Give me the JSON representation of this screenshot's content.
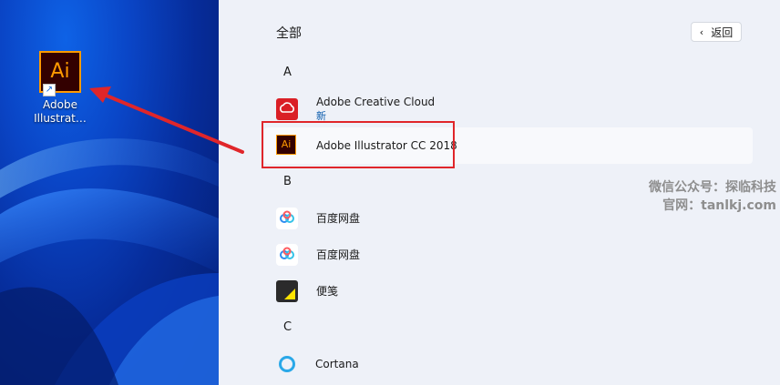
{
  "desktop": {
    "shortcut_label": "Adobe Illustrat…",
    "shortcut_label_line1": "Adobe",
    "shortcut_label_line2": "Illustrat…",
    "icon_text": "Ai"
  },
  "start_menu": {
    "section_title": "全部",
    "back_label": "返回",
    "groups": [
      {
        "letter": "A",
        "apps": [
          {
            "name": "Adobe Creative Cloud",
            "sub": "新",
            "icon": "creative-cloud-icon"
          },
          {
            "name": "Adobe Illustrator CC 2018",
            "icon": "illustrator-icon",
            "icon_text": "Ai"
          }
        ]
      },
      {
        "letter": "B",
        "apps": [
          {
            "name": "百度网盘",
            "icon": "baidu-netdisk-icon"
          },
          {
            "name": "百度网盘",
            "icon": "baidu-netdisk-icon"
          },
          {
            "name": "便笺",
            "icon": "sticky-notes-icon"
          }
        ]
      },
      {
        "letter": "C",
        "apps": [
          {
            "name": "Cortana",
            "icon": "cortana-icon"
          }
        ]
      }
    ]
  },
  "watermark": {
    "line1": "微信公众号：探临科技",
    "line2": "官网：tanlkj.com"
  },
  "colors": {
    "highlight_border": "#e0262a",
    "arrow": "#e0262a",
    "illustrator_orange": "#ff9a00",
    "illustrator_bg": "#330000",
    "creative_cloud_red": "#da1f26",
    "panel_bg": "#eef1f8"
  }
}
